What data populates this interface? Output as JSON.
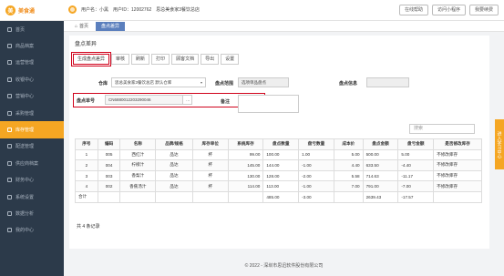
{
  "header": {
    "logo_text": "美食通",
    "username": "用户名：小黑",
    "userid": "用户ID：12002762",
    "store": "思总美食家3餐饮总店",
    "buttons": [
      "在线帮助",
      "访问小程序",
      "我要续费"
    ]
  },
  "sidebar": {
    "items": [
      {
        "label": "首页",
        "active": false
      },
      {
        "label": "商品档案",
        "active": false
      },
      {
        "label": "运营管理",
        "active": false
      },
      {
        "label": "收银中心",
        "active": false
      },
      {
        "label": "营销中心",
        "active": false
      },
      {
        "label": "采购管理",
        "active": false
      },
      {
        "label": "库存管理",
        "active": true
      },
      {
        "label": "配送管理",
        "active": false
      },
      {
        "label": "供应商档案",
        "active": false
      },
      {
        "label": "财务中心",
        "active": false
      },
      {
        "label": "系统设置",
        "active": false
      },
      {
        "label": "数据分析",
        "active": false
      },
      {
        "label": "我的中心",
        "active": false
      }
    ]
  },
  "tabs": [
    {
      "label": "首页",
      "active": false
    },
    {
      "label": "盘点差异",
      "active": true
    }
  ],
  "page": {
    "title": "盘点差异",
    "toolbar": [
      "生成盘点差异",
      "审核",
      "刷新",
      "打印",
      "顾客文档",
      "导出",
      "设置"
    ]
  },
  "form": {
    "warehouse_label": "仓库",
    "warehouse_value": "思总美食家3餐饮总店 默认仓库",
    "range_label": "盘点范围",
    "range_value": "选项单品盘点",
    "info_label": "盘点信息",
    "info_value": "",
    "order_label": "盘点单号",
    "order_value": "CN6880012203290046",
    "remark_label": "备注",
    "remark_value": ""
  },
  "search": {
    "placeholder": "搜索"
  },
  "table": {
    "headers": [
      "序号",
      "编码",
      "名称",
      "品牌/规格",
      "库存单位",
      "系统库存",
      "盘点数量",
      "盘亏数量",
      "成本价",
      "盘点金额",
      "盘亏金额",
      "是否修改库存"
    ],
    "rows": [
      [
        "1",
        "005",
        "西红汁",
        "品达",
        "杯",
        "99.00",
        "100.00",
        "1.00",
        "5.00",
        "500.00",
        "5.00",
        "不修改库存"
      ],
      [
        "2",
        "004",
        "柠檬汁",
        "品达",
        "杯",
        "145.00",
        "144.00",
        "-1.00",
        "4.40",
        "633.50",
        "-4.40",
        "不修改库存"
      ],
      [
        "3",
        "003",
        "香梨汁",
        "品达",
        "杯",
        "130.00",
        "128.00",
        "-2.00",
        "5.58",
        "714.63",
        "-11.17",
        "不修改库存"
      ],
      [
        "4",
        "002",
        "香蕉汤汁",
        "品达",
        "杯",
        "114.00",
        "113.00",
        "-1.00",
        "7.00",
        "791.00",
        "-7.00",
        "不修改库存"
      ]
    ],
    "totals": [
      "合计",
      "",
      "",
      "",
      "",
      "",
      "485.00",
      "-3.00",
      "",
      "2639.43",
      "-17.57",
      ""
    ]
  },
  "record_count": "共 4 条记录",
  "footer": "© 2022 - 深圳市思迅软件股份有限公司",
  "floater": "进入学习中心",
  "colors": {
    "accent": "#f5a623",
    "sidebar": "#2c3a4a",
    "highlight": "#d0021b",
    "tab": "#5b7fbd"
  }
}
